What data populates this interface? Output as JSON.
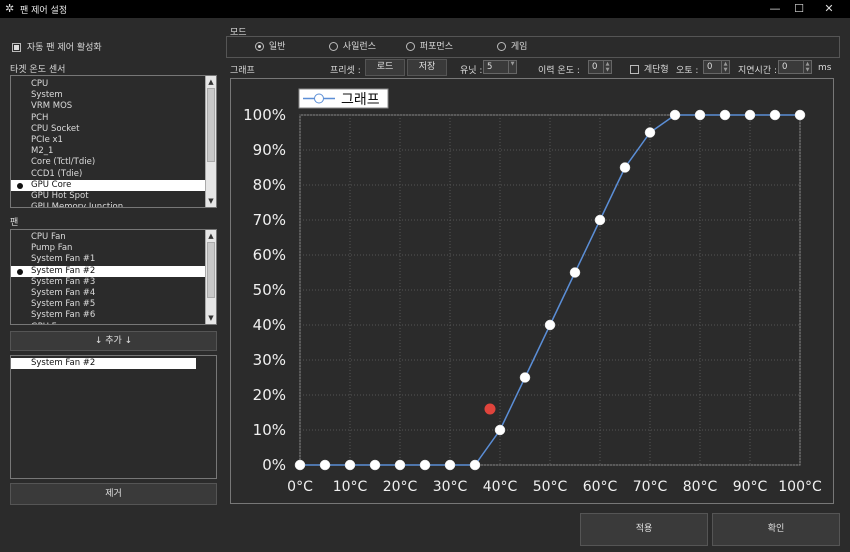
{
  "window": {
    "title": "팬 제어 설정",
    "icon": "fan-icon"
  },
  "auto_control": {
    "label": "자동 팬 제어 활성화",
    "checked": true
  },
  "mode": {
    "title": "모드",
    "options": [
      {
        "label": "일반",
        "selected": true
      },
      {
        "label": "사일런스",
        "selected": false
      },
      {
        "label": "퍼포먼스",
        "selected": false
      },
      {
        "label": "게임",
        "selected": false
      }
    ]
  },
  "target_sensor": {
    "title": "타겟 온도 센서",
    "items": [
      "CPU",
      "System",
      "VRM MOS",
      "PCH",
      "CPU Socket",
      "PCIe x1",
      "M2_1",
      "Core (Tctl/Tdie)",
      "CCD1 (Tdie)",
      "GPU Core",
      "GPU Hot Spot",
      "GPU Memory Junction"
    ],
    "selected_index": 9
  },
  "fan": {
    "title": "팬",
    "items": [
      "CPU Fan",
      "Pump Fan",
      "System Fan #1",
      "System Fan #2",
      "System Fan #3",
      "System Fan #4",
      "System Fan #5",
      "System Fan #6",
      "GPU Fan"
    ],
    "selected_index": 3
  },
  "add_button": "↓ 추가 ↓",
  "added_list": {
    "items": [
      "System Fan #2"
    ]
  },
  "remove_button": "제거",
  "toolbar": {
    "graph_label": "그래프",
    "preset_label": "프리셋 :",
    "load_button": "로드",
    "save_button": "저장",
    "unit_label": "유닛 :",
    "unit_value": "5",
    "history_temp_label": "이력 온도 :",
    "history_temp_value": "0",
    "step_label": "계단형",
    "step_checked": false,
    "offset_label": "오토 :",
    "offset_value": "0",
    "delay_label": "지연시간 :",
    "delay_value": "0",
    "delay_unit": "ms"
  },
  "chart_data": {
    "type": "line",
    "legend": "그래프",
    "x": [
      0,
      5,
      10,
      15,
      20,
      25,
      30,
      35,
      40,
      45,
      50,
      55,
      60,
      65,
      70,
      75,
      80,
      85,
      90,
      95,
      100
    ],
    "y": [
      0,
      0,
      0,
      0,
      0,
      0,
      0,
      0,
      10,
      25,
      40,
      55,
      70,
      85,
      95,
      100,
      100,
      100,
      100,
      100,
      100
    ],
    "current_point": {
      "x": 38,
      "y": 16
    },
    "xlim": [
      0,
      100
    ],
    "ylim": [
      0,
      100
    ],
    "xticks": [
      "0°C",
      "10°C",
      "20°C",
      "30°C",
      "40°C",
      "50°C",
      "60°C",
      "70°C",
      "80°C",
      "90°C",
      "100°C"
    ],
    "yticks": [
      "0%",
      "10%",
      "20%",
      "30%",
      "40%",
      "50%",
      "60%",
      "70%",
      "80%",
      "90%",
      "100%"
    ],
    "line_color": "#5b8ed6",
    "point_color": "#ffffff",
    "current_color": "#e0443c",
    "grid": true
  },
  "footer": {
    "apply_button": "적용",
    "ok_button": "확인"
  }
}
